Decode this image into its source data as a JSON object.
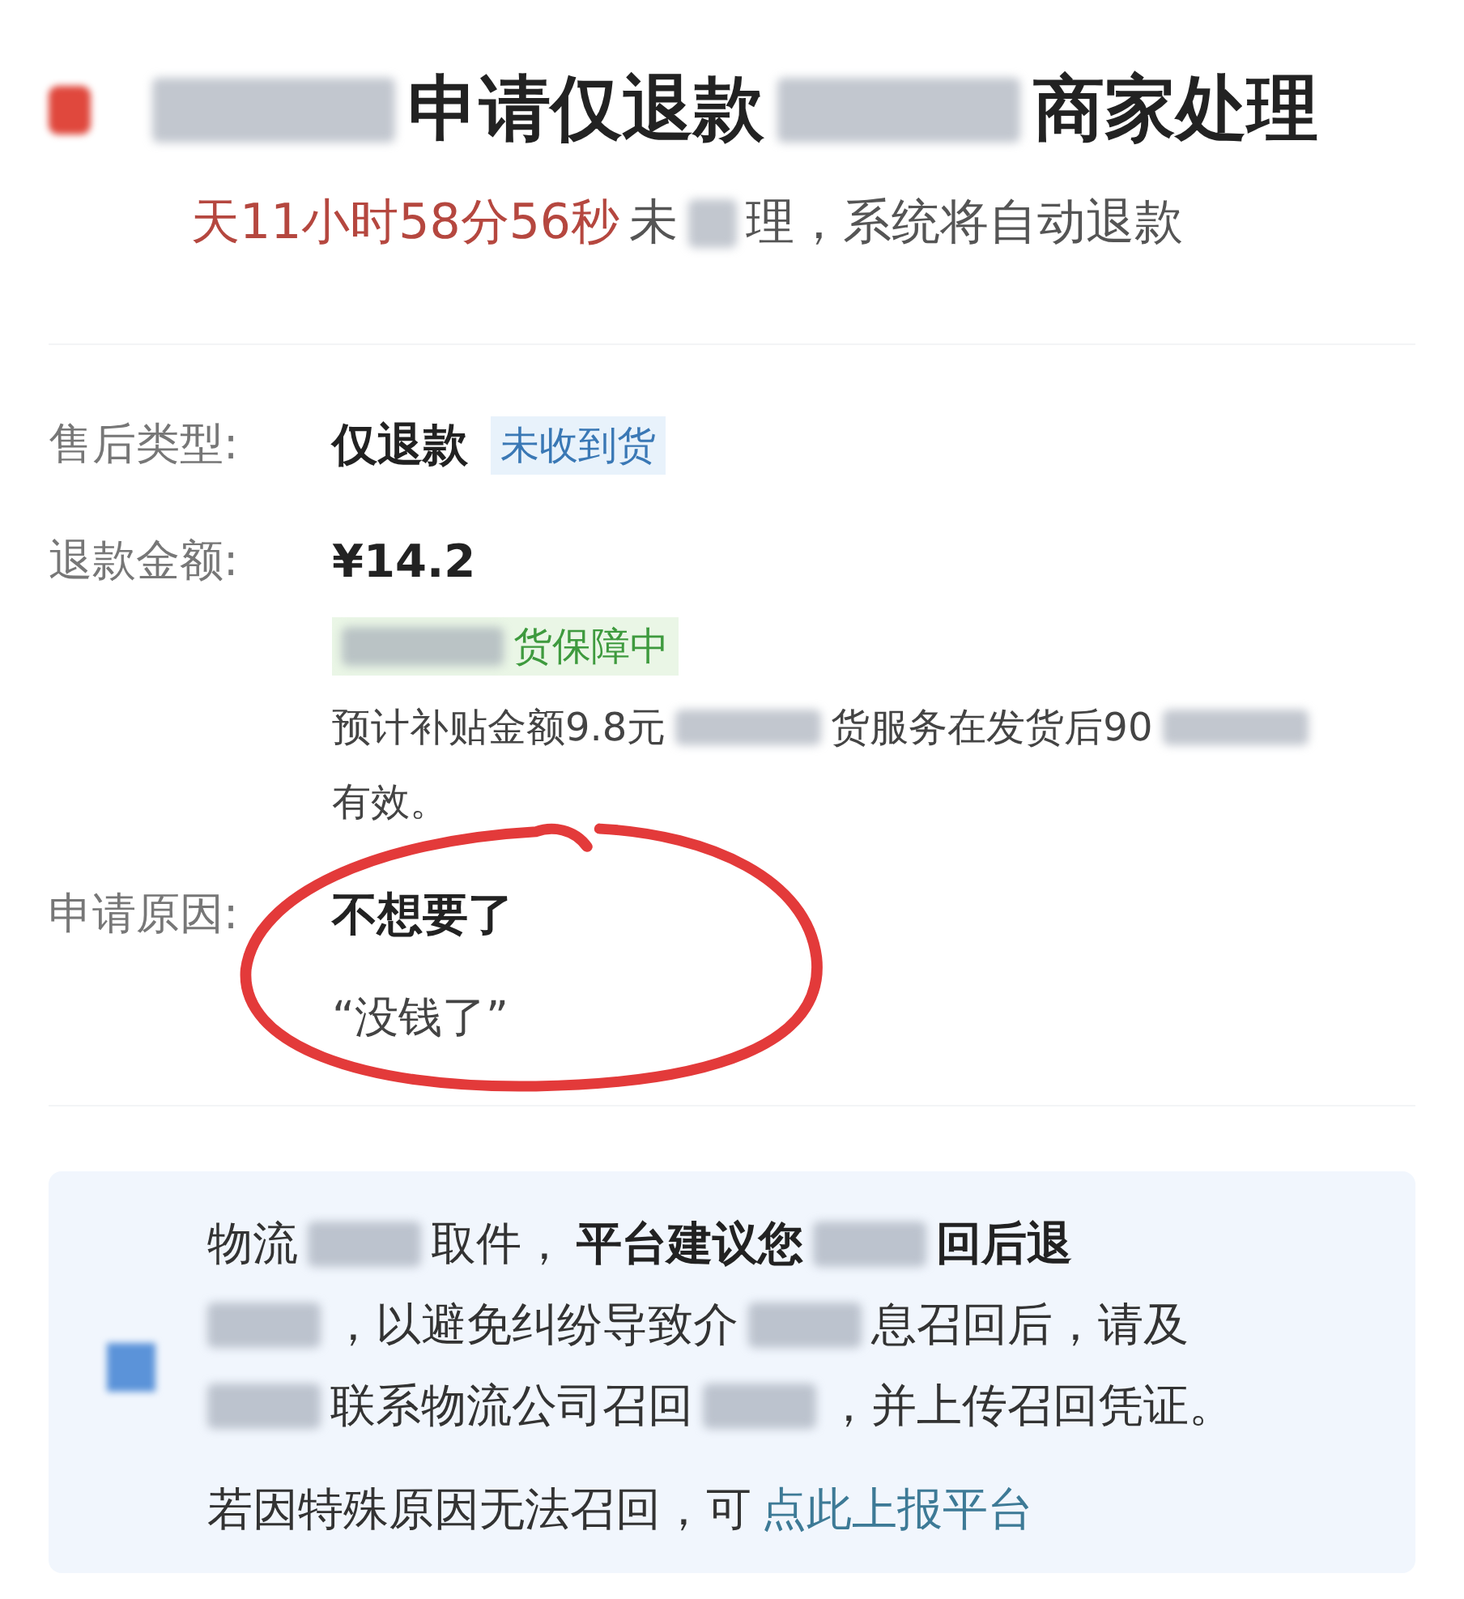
{
  "header": {
    "title": [
      {
        "kind": "redacted"
      },
      {
        "kind": "text",
        "text": "申请仅退款"
      },
      {
        "kind": "redacted"
      },
      {
        "kind": "text",
        "text": "商家处理"
      }
    ],
    "countdown": [
      {
        "kind": "highlight",
        "text": "天11小时58分56秒"
      },
      {
        "kind": "text",
        "text": "未"
      },
      {
        "kind": "redacted"
      },
      {
        "kind": "text",
        "text": "理，系统将自动退款"
      }
    ]
  },
  "fields": [
    {
      "label": "售后类型:",
      "value": "仅退款",
      "tag": "未收到货"
    },
    {
      "label": "退款金额:",
      "value": "¥14.2",
      "badge": [
        {
          "kind": "redacted"
        },
        {
          "kind": "text",
          "text": "货保障中"
        }
      ],
      "note": [
        [
          {
            "kind": "text",
            "text": "预计补贴金额9.8元"
          },
          {
            "kind": "redacted"
          },
          {
            "kind": "text",
            "text": "货服务在发货后90"
          },
          {
            "kind": "redacted"
          }
        ],
        [
          {
            "kind": "text",
            "text": "有效。"
          }
        ]
      ]
    },
    {
      "label": "申请原因:",
      "value": "不想要了",
      "quote": "“没钱了”"
    }
  ],
  "notice": {
    "lines": [
      [
        {
          "kind": "text",
          "text": "物流"
        },
        {
          "kind": "redacted"
        },
        {
          "kind": "text",
          "text": "取件，"
        },
        {
          "kind": "bold",
          "text": "平台建议您"
        },
        {
          "kind": "redacted"
        },
        {
          "kind": "bold",
          "text": "回后退"
        }
      ],
      [
        {
          "kind": "redacted"
        },
        {
          "kind": "text",
          "text": "，以避免纠纷导致介"
        },
        {
          "kind": "redacted"
        },
        {
          "kind": "text",
          "text": "息召回后，请及"
        }
      ],
      [
        {
          "kind": "redacted"
        },
        {
          "kind": "text",
          "text": "联系物流公司召回"
        },
        {
          "kind": "redacted"
        },
        {
          "kind": "text",
          "text": "，并上传召回凭证。"
        }
      ]
    ],
    "footer": [
      {
        "kind": "text",
        "text": "若因特殊原因无法召回，可"
      },
      {
        "kind": "link",
        "text": "点此上报平台"
      }
    ]
  }
}
